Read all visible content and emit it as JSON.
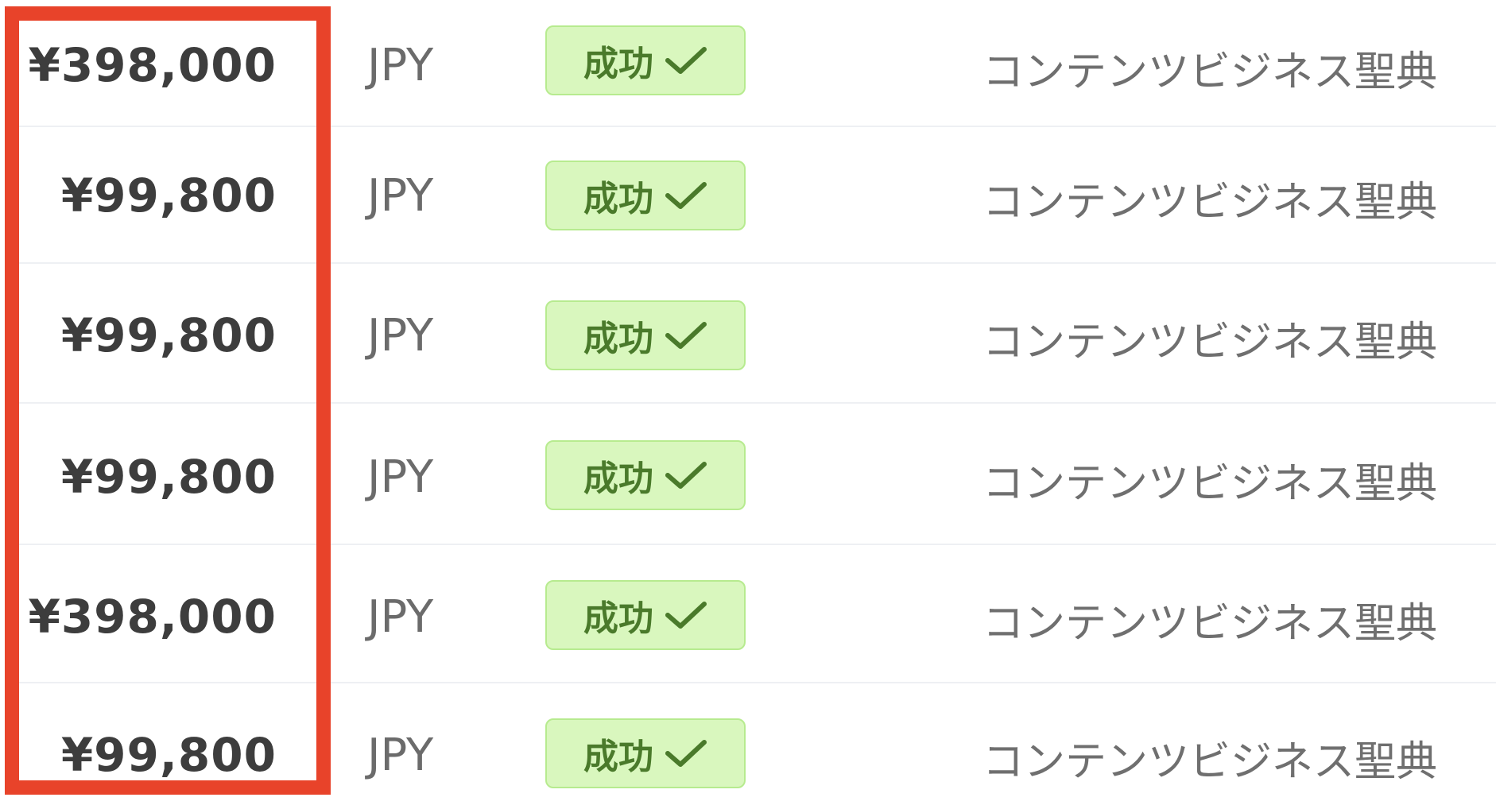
{
  "rows": [
    {
      "amount": "¥398,000",
      "currency": "JPY",
      "status": "成功",
      "description": "コンテンツビジネス聖典"
    },
    {
      "amount": "¥99,800",
      "currency": "JPY",
      "status": "成功",
      "description": "コンテンツビジネス聖典"
    },
    {
      "amount": "¥99,800",
      "currency": "JPY",
      "status": "成功",
      "description": "コンテンツビジネス聖典"
    },
    {
      "amount": "¥99,800",
      "currency": "JPY",
      "status": "成功",
      "description": "コンテンツビジネス聖典"
    },
    {
      "amount": "¥398,000",
      "currency": "JPY",
      "status": "成功",
      "description": "コンテンツビジネス聖典"
    },
    {
      "amount": "¥99,800",
      "currency": "JPY",
      "status": "成功",
      "description": "コンテンツビジネス聖典"
    }
  ],
  "colors": {
    "highlight_border": "#e8432a",
    "badge_background": "#d9f7be",
    "badge_border": "#b7eb8f",
    "badge_text": "#4a7a2b"
  },
  "icons": {
    "status_icon": "check-icon"
  }
}
